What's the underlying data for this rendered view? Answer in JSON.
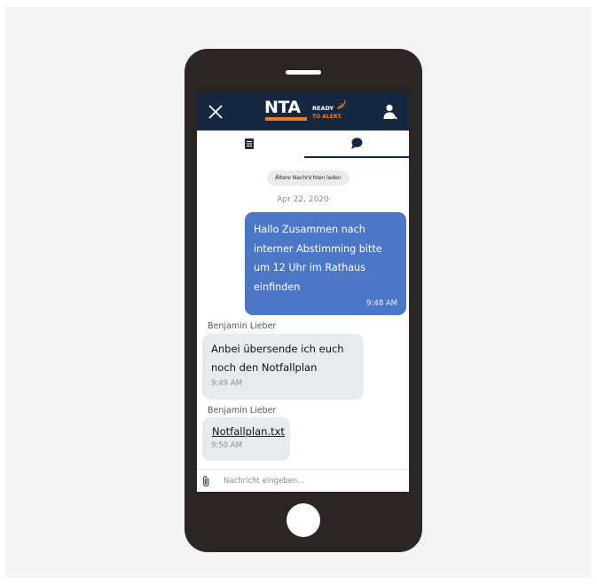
{
  "header": {
    "logo_main": "NTA",
    "logo_line1": "READY",
    "logo_line2": "TO ALERT.",
    "accent_color": "#ee7a22",
    "header_color": "#15283f"
  },
  "tabs": [
    {
      "icon": "document-icon",
      "active": false
    },
    {
      "icon": "chat-bubble-icon",
      "active": true
    }
  ],
  "chat": {
    "load_older_label": "Ältere Nachrichten laden",
    "date_label": "Apr 22, 2020",
    "messages": [
      {
        "direction": "outgoing",
        "text": "Hallo Zusammen nach interner Abstimming bitte um 12 Uhr im Rathaus einfinden",
        "time": "9:48 AM",
        "bubble_color": "#4b77c6"
      },
      {
        "direction": "incoming",
        "sender": "Benjamin Lieber",
        "text": "Anbei übersende ich euch noch den Notfallplan",
        "time": "9:49 AM"
      },
      {
        "direction": "incoming",
        "sender": "Benjamin Lieber",
        "attachment": "Notfallplan.txt",
        "time": "9:50 AM"
      }
    ]
  },
  "composer": {
    "placeholder": "Nachricht eingeben...",
    "value": ""
  }
}
